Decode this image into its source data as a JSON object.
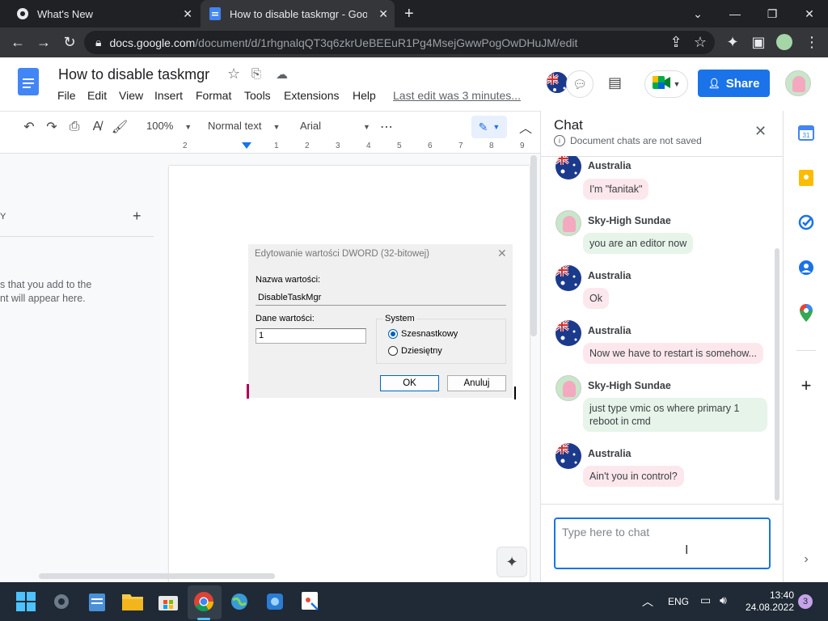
{
  "browser": {
    "tabs": [
      {
        "title": "What's New"
      },
      {
        "title": "How to disable taskmgr - Google Docs"
      }
    ],
    "url_host": "docs.google.com",
    "url_path": "/document/d/1rhgnalqQT3q6zkrUeBEEuR1Pg4MsejGwwPogOwDHuJM/edit"
  },
  "docs": {
    "title": "How to disable taskmgr",
    "menu": [
      "File",
      "Edit",
      "View",
      "Insert",
      "Format",
      "Tools",
      "Extensions",
      "Help"
    ],
    "last_edit": "Last edit was 3 minutes...",
    "share_label": "Share",
    "toolbar": {
      "zoom": "100%",
      "style": "Normal text",
      "font": "Arial"
    },
    "ruler_ticks": [
      "2",
      "1",
      "1",
      "2",
      "3",
      "4",
      "5",
      "6",
      "7",
      "8",
      "9"
    ],
    "outline": {
      "header_letter": "Y",
      "hint": "s that you add to the\nnt will appear here."
    }
  },
  "dword_dialog": {
    "title": "Edytowanie wartości DWORD (32-bitowej)",
    "name_label": "Nazwa wartości:",
    "name_value": "DisableTaskMgr",
    "data_label": "Dane wartości:",
    "data_value": "1",
    "system_label": "System",
    "options": [
      {
        "label": "Szesnastkowy",
        "selected": true
      },
      {
        "label": "Dziesiętny",
        "selected": false
      }
    ],
    "ok_label": "OK",
    "cancel_label": "Anuluj"
  },
  "chat": {
    "title": "Chat",
    "subtitle": "Document chats are not saved",
    "messages": [
      {
        "sender": "Australia",
        "text": "I'm \"fanitak\"",
        "avatar": "australia-flag",
        "bubble": "pink"
      },
      {
        "sender": "Sky-High Sundae",
        "text": "you are an editor now",
        "avatar": "sundae",
        "bubble": "green"
      },
      {
        "sender": "Australia",
        "text": "Ok",
        "avatar": "australia-flag",
        "bubble": "pink"
      },
      {
        "sender": "Australia",
        "text": "Now we have to restart is somehow...",
        "avatar": "australia-flag",
        "bubble": "pink"
      },
      {
        "sender": "Sky-High Sundae",
        "text": "just type vmic os where primary 1\nreboot in cmd",
        "avatar": "sundae",
        "bubble": "green"
      },
      {
        "sender": "Australia",
        "text": "Ain't you in control?",
        "avatar": "australia-flag",
        "bubble": "pink"
      }
    ],
    "input_placeholder": "Type here to chat"
  },
  "taskbar": {
    "lang": "ENG",
    "time": "13:40",
    "date": "24.08.2022",
    "notification_count": "3"
  },
  "colors": {
    "accent": "#1a73e8",
    "pink_bubble": "#fce8ec",
    "green_bubble": "#e6f4ea"
  }
}
